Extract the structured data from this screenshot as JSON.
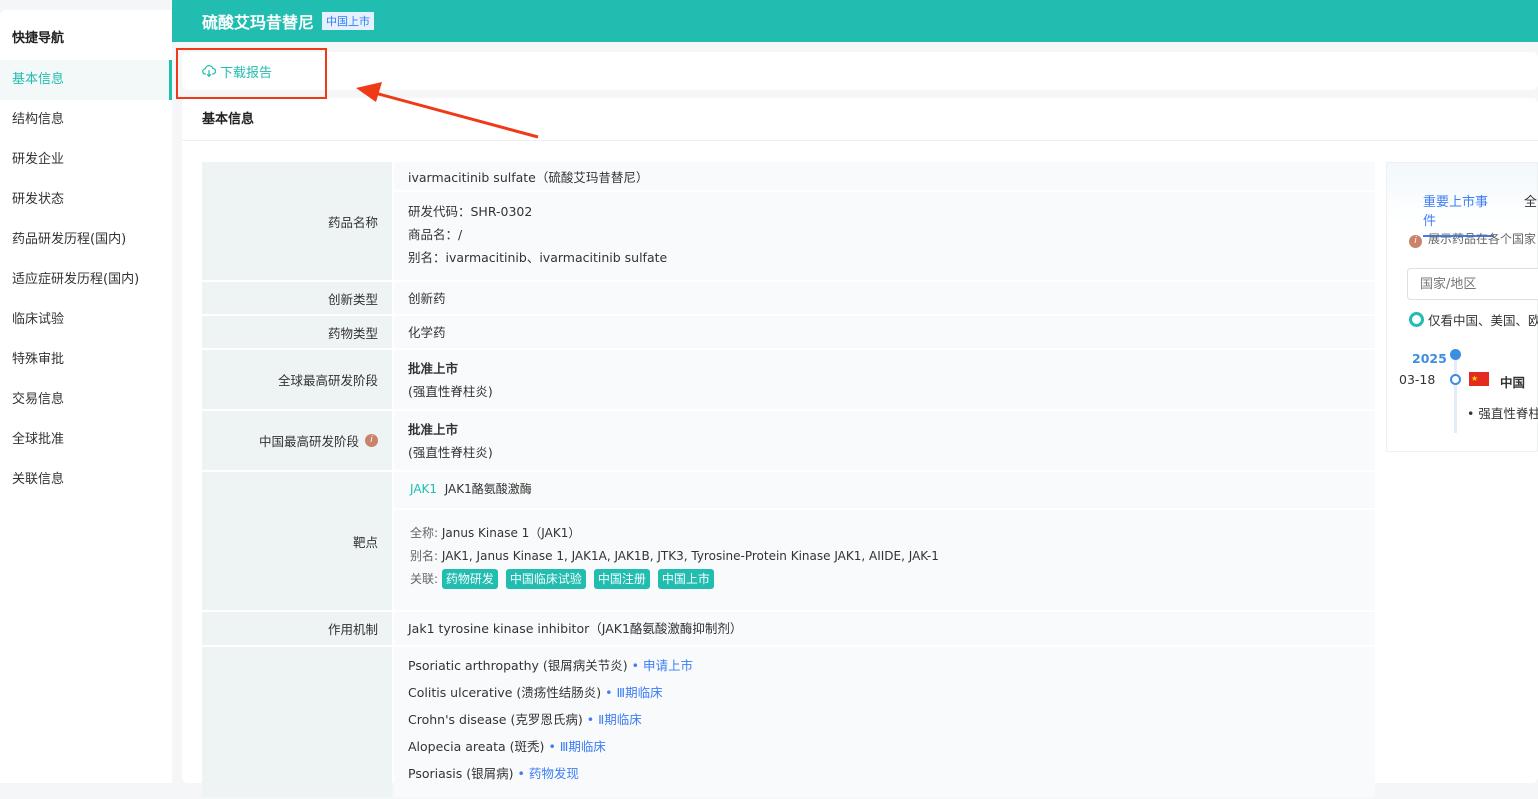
{
  "sidebar": {
    "title": "快捷导航",
    "items": [
      "基本信息",
      "结构信息",
      "研发企业",
      "研发状态",
      "药品研发历程(国内)",
      "适应症研发历程(国内)",
      "临床试验",
      "特殊审批",
      "交易信息",
      "全球批准",
      "关联信息"
    ]
  },
  "header": {
    "name": "硫酸艾玛昔替尼",
    "badge": "中国上市"
  },
  "download": "下载报告",
  "section_title": "基本信息",
  "rows": {
    "name": {
      "label": "药品名称",
      "line1": "ivarmacitinib sulfate（硫酸艾玛昔替尼）",
      "code": "研发代码：SHR-0302",
      "trade": "商品名：/",
      "alias": "别名：ivarmacitinib、ivarmacitinib sulfate"
    },
    "innov": {
      "label": "创新类型",
      "value": "创新药"
    },
    "dtype": {
      "label": "药物类型",
      "value": "化学药"
    },
    "global": {
      "label": "全球最高研发阶段",
      "value": "批准上市",
      "sub": "(强直性脊柱炎)"
    },
    "china": {
      "label": "中国最高研发阶段",
      "value": "批准上市",
      "sub": "(强直性脊柱炎)"
    },
    "target": {
      "label": "靶点",
      "code": "JAK1",
      "name": "JAK1酪氨酸激酶",
      "full_label": "全称:",
      "full": "Janus Kinase 1（JAK1）",
      "alias_label": "别名:",
      "alias": "JAK1, Janus Kinase 1, JAK1A, JAK1B, JTK3, Tyrosine-Protein Kinase JAK1, AIIDE, JAK-1",
      "rel_label": "关联:",
      "tags": [
        "药物研发",
        "中国临床试验",
        "中国注册",
        "中国上市"
      ]
    },
    "mech": {
      "label": "作用机制",
      "value": "Jak1 tyrosine kinase inhibitor（JAK1酪氨酸激酶抑制剂）"
    },
    "indications": [
      {
        "name": "Psoriatic arthropathy (银屑病关节炎)",
        "stage": "申请上市"
      },
      {
        "name": "Colitis ulcerative (溃疡性结肠炎)",
        "stage": "Ⅲ期临床"
      },
      {
        "name": "Crohn's disease (克罗恩氏病)",
        "stage": "Ⅱ期临床"
      },
      {
        "name": "Alopecia areata (斑秃)",
        "stage": "Ⅲ期临床"
      },
      {
        "name": "Psoriasis (银屑病)",
        "stage": "药物发现"
      }
    ]
  },
  "right": {
    "tab1": "重要上市事件",
    "tab2": "全",
    "hint": "展示药品在各个国家",
    "placeholder": "国家/地区",
    "radio": "仅看中国、美国、欧",
    "year": "2025",
    "date": "03-18",
    "country": "中国",
    "event": "• 强直性脊柱"
  }
}
